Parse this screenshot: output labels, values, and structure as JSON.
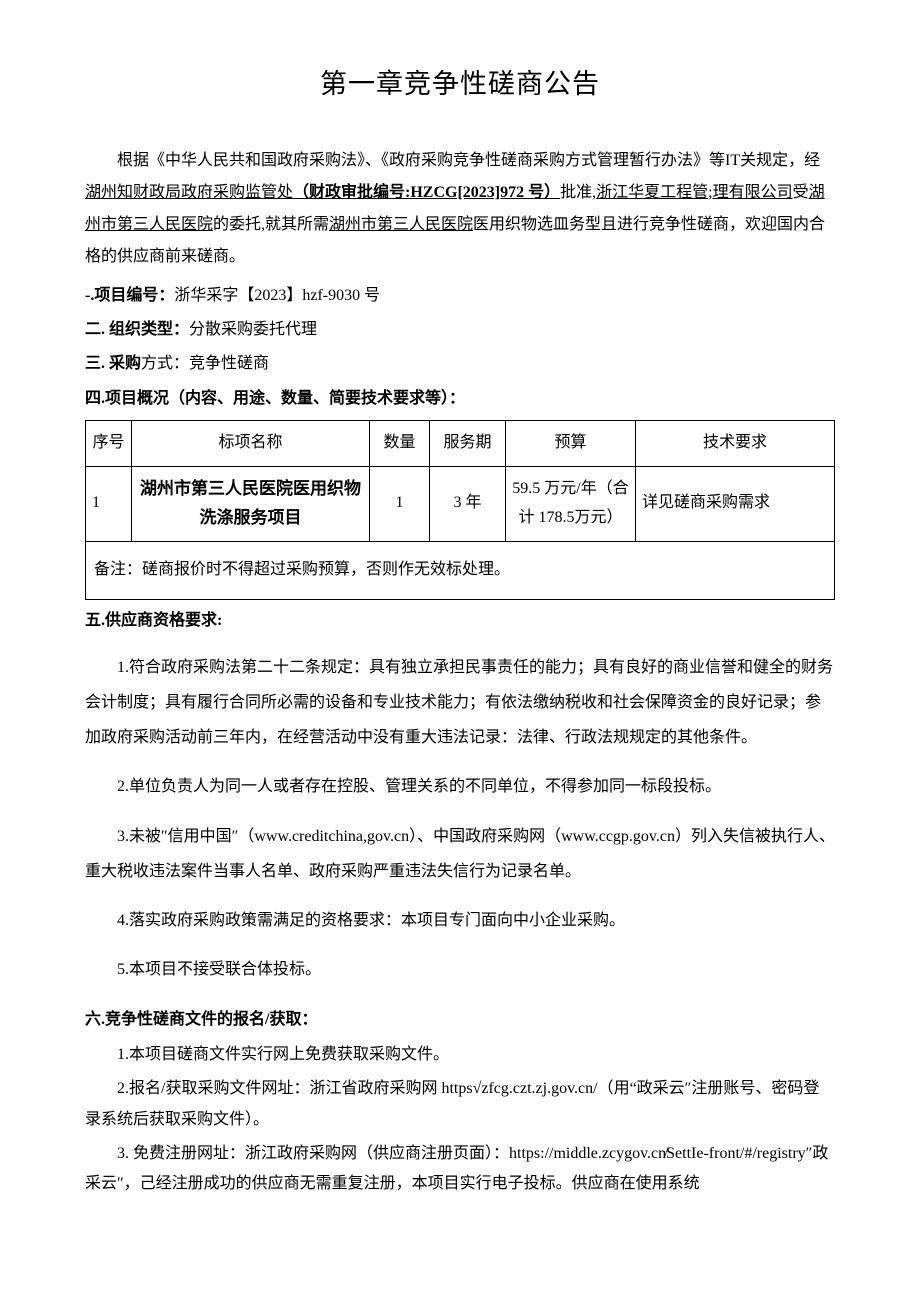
{
  "title": "第一章竞争性磋商公告",
  "intro_p1": "根据《中华人民共和国政府采购法》、《政府采购竞争性磋商采购方式管理暂行办法》等IT关规定，经",
  "intro_u1": "湖州知财政局政府采购监管处",
  "intro_b1": "（财政审批编号:HZCG[2023]972 号）",
  "intro_p2": "批准,",
  "intro_u2": "浙江华夏工程管;理有限公司",
  "intro_p3": "受",
  "intro_u3": "湖州市第三人民医院",
  "intro_p4": "的委托,就其所需",
  "intro_u4": "湖州市第三人民医院",
  "intro_p5": "医用织物选皿务型且进行竞争性磋商，欢迎国内合格的供应商前来磋商。",
  "s1_label": "-.项目编号：",
  "s1_value": "浙华采字【2023】hzf-9030 号",
  "s2_label": "二. 组织类型：",
  "s2_value": "分散采购委托代理",
  "s3_label": "三. 采购",
  "s3_value": "方式：竞争性磋商",
  "s4_label": "四.项目概况（内容、用途、数量、简要技术要求等）：",
  "table": {
    "h1": "序号",
    "h2": "标项名称",
    "h3": "数量",
    "h4": "服务期",
    "h5": "预算",
    "h6": "技术要求",
    "r1c1": "1",
    "r1c2": "湖州市第三人民医院医用织物洗涤服务项目",
    "r1c3": "1",
    "r1c4": "3 年",
    "r1c5": "59.5 万元/年（合计 178.5万元）",
    "r1c6": "详见磋商采购需求",
    "note": "备注：磋商报价时不得超过采购预算，否则作无效标处理。"
  },
  "s5_label": "五.供应商资格要求:",
  "s5_1": "1.符合政府采购法第二十二条规定：具有独立承担民事责任的能力；具有良好的商业信誉和健全的财务会计制度；具有履行合同所必需的设备和专业技术能力；有依法缴纳税收和社会保障资金的良好记录；参加政府采购活动前三年内，在经营活动中没有重大违法记录：法律、行政法规规定的其他条件。",
  "s5_2": "2.单位负责人为同一人或者存在控股、管理关系的不同单位，不得参加同一标段投标。",
  "s5_3": "3.未被″信用中国″（www.creditchina,gov.cn）、中国政府采购网（www.ccgp.gov.cn）列入失信被执行人、重大税收违法案件当事人名单、政府采购严重违法失信行为记录名单。",
  "s5_4": "4.落实政府采购政策需满足的资格要求：本项目专门面向中小企业采购。",
  "s5_5": "5.本项目不接受联合体投标。",
  "s6_label": "六.竞争性磋商文件的报名/获取：",
  "s6_1": "1.本项目磋商文件实行网上免费获取采购文件。",
  "s6_2": "2.报名/获取采购文件网址：浙江省政府采购网 https√zfcg.czt.zj.gov.cn/（用“政采云″注册账号、密码登录系统后获取采购文件）。",
  "s6_3": "3. 免费注册网址：浙江政府采购网（供应商注册页面）：https://middle.zcygov.cn̸SettIe-front/#/registry″政采云″，己经注册成功的供应商无需重复注册，本项目实行电子投标。供应商在使用系统"
}
